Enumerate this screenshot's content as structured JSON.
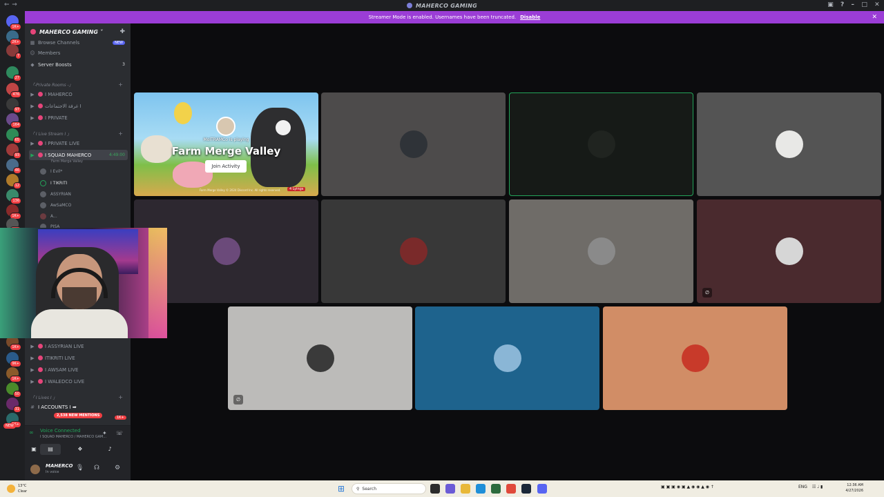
{
  "window": {
    "title": "MAHERCO GAMING"
  },
  "banner": {
    "text": "Streamer Mode is enabled. Usernames have been truncated.",
    "action": "Disable"
  },
  "rail": {
    "badges": [
      "1K+",
      "2K+",
      "7",
      "27",
      "476",
      "97",
      "164",
      "65",
      "93",
      "46",
      "12",
      "136",
      "1K+",
      "1K+",
      "1K+",
      "9K+",
      "1K+",
      "50",
      "31",
      "1K+"
    ],
    "new_label": "NEW"
  },
  "sidebar": {
    "server_name": "MAHERCO GAMING",
    "top_items": [
      {
        "label": "Browse Channels",
        "badge": "NEW"
      },
      {
        "label": "Members"
      },
      {
        "label": "Server Boosts",
        "count": "3"
      }
    ],
    "categories": {
      "private": "「-Private Rooms -」",
      "live": "「 I Live Stream I 」",
      "lives": "「 I Lives I 」"
    },
    "private_channels": [
      "I MAHERCO",
      "غرفة الاجتماعات I",
      "I PRIVATE"
    ],
    "live_channels": [
      {
        "label": "I PRIVATE LIVE"
      },
      {
        "label": "I SQUAD MAHERCO",
        "time": "4:49:00",
        "activity": "Farm Merge Valley"
      }
    ],
    "members": [
      "I Evil*",
      "I TIKRITI",
      "ASSYRIAN",
      "AwSaMCO",
      "A...",
      "PISA"
    ],
    "lower_channels": [
      "I ASSYRIAN LIVE",
      "ITIKRITI LIVE",
      "I AWSAM LIVE",
      "I WALEDCO LIVE"
    ],
    "text_channel": "I ACCOUNTS I ➡",
    "mentions": "2,538 NEW MENTIONS",
    "mentions_count": "1K+"
  },
  "voice": {
    "status": "Voice Connected",
    "channel": "I SQUAD MAHERCO / MAHERCO GAM..."
  },
  "user": {
    "name": "MAHERCO",
    "status": "In voice"
  },
  "activity": {
    "host": "MoITRAMCo is playing",
    "game": "Farm Merge Valley",
    "join": "Join Activity",
    "legal": "Farm Merge Valley © 2024 Discord Inc. All rights reserved.",
    "players": "4 Lyings"
  },
  "tiles": [
    {
      "bg": "#4d4b4b",
      "muted": false,
      "speaking": false
    },
    {
      "bg": "#161a17",
      "muted": false,
      "speaking": true
    },
    {
      "bg": "#545454",
      "muted": false,
      "speaking": false
    },
    {
      "bg": "#2d2830",
      "muted": false,
      "speaking": false
    },
    {
      "bg": "#383838",
      "muted": false,
      "speaking": false
    },
    {
      "bg": "#6f6c68",
      "muted": false,
      "speaking": false
    },
    {
      "bg": "#4a2a2e",
      "muted": true,
      "speaking": false
    },
    {
      "bg": "#bcbbb9",
      "muted": true,
      "speaking": false
    },
    {
      "bg": "#1e638d",
      "muted": false,
      "speaking": false
    },
    {
      "bg": "#d18d66",
      "muted": false,
      "speaking": false
    }
  ],
  "taskbar": {
    "weather_temp": "13°C",
    "weather_desc": "Clear",
    "search": "Search",
    "lang": "ENG",
    "time": "12:36 AM",
    "date": "4/27/2026"
  }
}
